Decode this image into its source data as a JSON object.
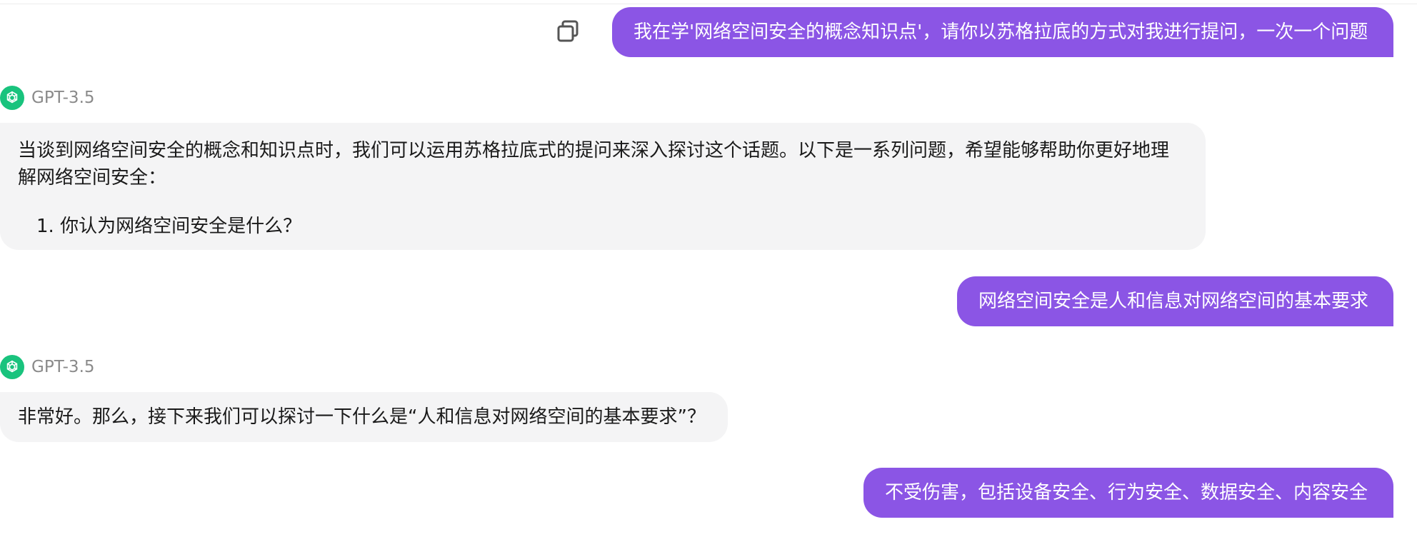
{
  "messages": [
    {
      "role": "user",
      "text": "我在学'网络空间安全的概念知识点'，请你以苏格拉底的方式对我进行提问，一次一个问题"
    },
    {
      "role": "assistant",
      "model": "GPT-3.5",
      "paragraph": "当谈到网络空间安全的概念和知识点时，我们可以运用苏格拉底式的提问来深入探讨这个话题。以下是一系列问题，希望能够帮助你更好地理解网络空间安全：",
      "list_item": "1. 你认为网络空间安全是什么？"
    },
    {
      "role": "user",
      "text": "网络空间安全是人和信息对网络空间的基本要求"
    },
    {
      "role": "assistant",
      "model": "GPT-3.5",
      "paragraph": "非常好。那么，接下来我们可以探讨一下什么是“人和信息对网络空间的基本要求”？"
    },
    {
      "role": "user",
      "text": "不受伤害，包括设备安全、行为安全、数据安全、内容安全"
    }
  ],
  "icons": {
    "copy": "copy-icon",
    "avatar": "openai-logo-icon"
  },
  "colors": {
    "user_bubble": "#8b55e5",
    "assistant_bubble": "#f4f4f5",
    "avatar": "#19c37d"
  }
}
